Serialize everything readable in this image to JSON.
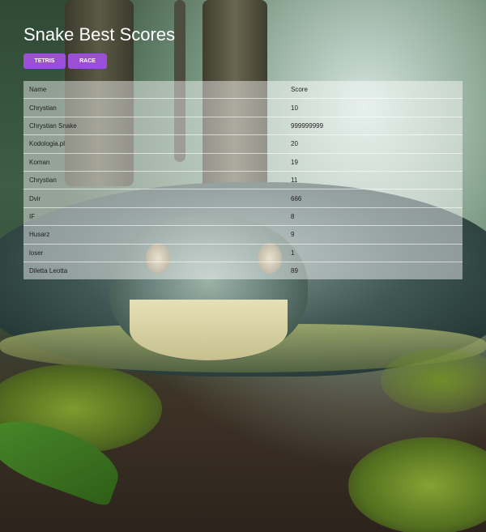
{
  "title": "Snake Best Scores",
  "tabs": [
    {
      "label": "TETRIS"
    },
    {
      "label": "RACE"
    }
  ],
  "table": {
    "headers": {
      "name": "Name",
      "score": "Score"
    },
    "rows": [
      {
        "name": "Chrystian",
        "score": "10"
      },
      {
        "name": "Chrystian Snake",
        "score": "999999999"
      },
      {
        "name": "Kodologia.pl",
        "score": "20"
      },
      {
        "name": "Koman",
        "score": "19"
      },
      {
        "name": "Chrystian",
        "score": "11"
      },
      {
        "name": "Dvir",
        "score": "666"
      },
      {
        "name": "IF",
        "score": "8"
      },
      {
        "name": "Husarz",
        "score": "9"
      },
      {
        "name": "loser",
        "score": "1"
      },
      {
        "name": "Diletta Leotta",
        "score": "89"
      }
    ]
  },
  "colors": {
    "button": "#9a4fd6",
    "title": "#ffffff"
  }
}
